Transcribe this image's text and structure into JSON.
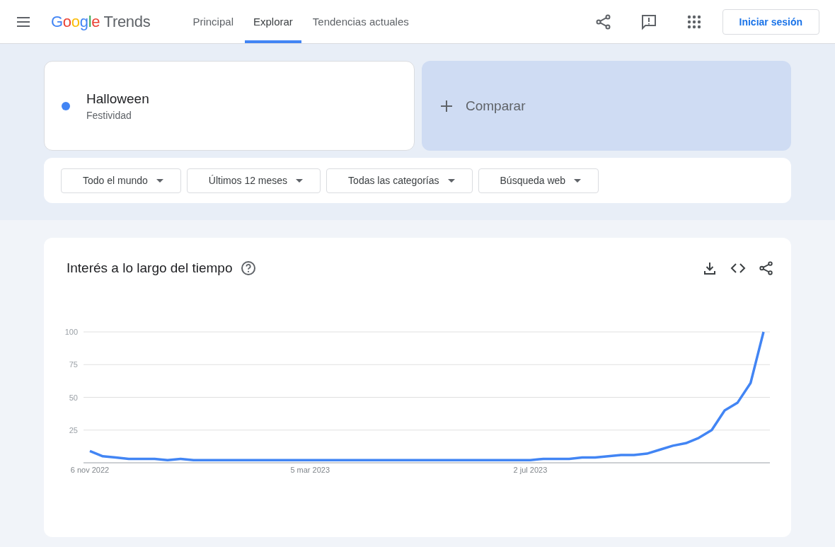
{
  "header": {
    "logo": {
      "brand": "Google",
      "product": "Trends"
    },
    "nav": [
      {
        "label": "Principal",
        "selected": false
      },
      {
        "label": "Explorar",
        "selected": true
      },
      {
        "label": "Tendencias actuales",
        "selected": false
      }
    ],
    "sign_in": "Iniciar sesión"
  },
  "search_term": {
    "term": "Halloween",
    "type": "Festividad",
    "color": "#4285f4"
  },
  "compare": {
    "label": "Comparar"
  },
  "filters": [
    {
      "label": "Todo el mundo"
    },
    {
      "label": "Últimos 12 meses"
    },
    {
      "label": "Todas las categorías"
    },
    {
      "label": "Búsqueda web"
    }
  ],
  "interest_card": {
    "title": "Interés a lo largo del tiempo",
    "chart_data": {
      "type": "line",
      "categories": [
        "6 nov 2022",
        null,
        null,
        null,
        null,
        null,
        null,
        null,
        null,
        null,
        null,
        null,
        null,
        null,
        null,
        null,
        null,
        "5 mar 2023",
        null,
        null,
        null,
        null,
        null,
        null,
        null,
        null,
        null,
        null,
        null,
        null,
        null,
        null,
        null,
        null,
        "2 jul 2023",
        null,
        null,
        null,
        null,
        null,
        null,
        null,
        null,
        null,
        null,
        null,
        null,
        null,
        null,
        null,
        null,
        null,
        null
      ],
      "series": [
        {
          "color": "#4285f4",
          "values": [
            9,
            5,
            4,
            3,
            3,
            3,
            2,
            3,
            2,
            2,
            2,
            2,
            2,
            2,
            2,
            2,
            2,
            2,
            2,
            2,
            2,
            2,
            2,
            2,
            2,
            2,
            2,
            2,
            2,
            2,
            2,
            2,
            2,
            2,
            2,
            3,
            3,
            3,
            4,
            4,
            5,
            6,
            6,
            7,
            10,
            13,
            15,
            19,
            25,
            40,
            46,
            61,
            100
          ]
        }
      ],
      "ylim": [
        0,
        100
      ],
      "grid": true,
      "yticks": [
        {
          "value": 25,
          "label": "25"
        },
        {
          "value": 50,
          "label": "50"
        },
        {
          "value": 75,
          "label": "75"
        },
        {
          "value": 100,
          "label": "100"
        }
      ]
    }
  }
}
